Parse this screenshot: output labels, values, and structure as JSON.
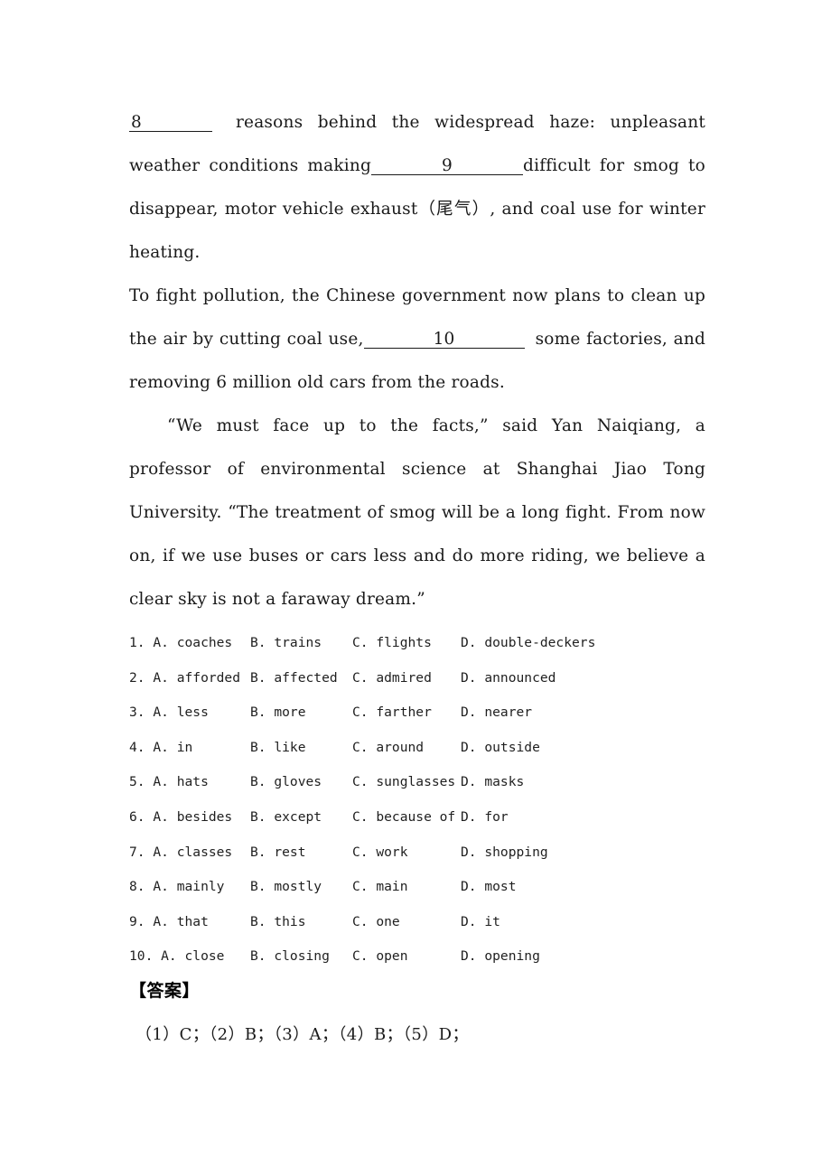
{
  "document": {
    "type": "cloze-test-worksheet",
    "background_color": "#ffffff",
    "text_color": "#1a1a1a"
  },
  "passage": {
    "paragraphs": [
      {
        "id": "p1",
        "indent": false,
        "segments": [
          {
            "kind": "blank",
            "number": "8",
            "style": "blank-8"
          },
          {
            "kind": "gap",
            "style": "gap-after-8"
          },
          {
            "kind": "text",
            "text": "reasons behind the widespread haze: unpleasant weather conditions making"
          },
          {
            "kind": "blank",
            "number": "9",
            "style": "blank-9"
          },
          {
            "kind": "text",
            "text": "difficult for smog to disappear, motor vehicle exhaust（尾气）, and coal use for winter heating."
          }
        ],
        "plain": "8______ reasons behind the widespread haze: unpleasant weather conditions making______9______difficult for smog to disappear, motor vehicle exhaust（尾气）, and coal use for winter heating."
      },
      {
        "id": "p2",
        "indent": false,
        "segments": [
          {
            "kind": "text",
            "text": "To fight pollution, the Chinese government now plans to clean up the air by cutting coal use,"
          },
          {
            "kind": "blank",
            "number": "10",
            "style": "blank-10"
          },
          {
            "kind": "gap",
            "style": "gap-after-10"
          },
          {
            "kind": "text",
            "text": "some factories, and removing 6 million old cars from the roads."
          }
        ],
        "plain": "To fight pollution, the Chinese government now plans to clean up the air by cutting coal use,______10______ some factories, and removing 6 million old cars from the roads."
      },
      {
        "id": "p3",
        "indent": true,
        "segments": [
          {
            "kind": "text",
            "text": "“We must face up to the facts,” said Yan Naiqiang, a professor of environmental science at Shanghai Jiao Tong University. “The treatment of smog will be a long fight. From now on, if we use buses or cars less and do more riding, we believe a clear sky is not a faraway dream.”"
          }
        ],
        "plain": "“We must face up to the facts,” said Yan Naiqiang, a professor of environmental science at Shanghai Jiao Tong University. “The treatment of smog will be a long fight. From now on, if we use buses or cars less and do more riding, we believe a clear sky is not a faraway dream.”"
      }
    ]
  },
  "questions": [
    {
      "number": "1",
      "a": "1. A. coaches",
      "b": "B. trains",
      "c": "C. flights",
      "d": "D. double-deckers"
    },
    {
      "number": "2",
      "a": "2. A. afforded",
      "b": "B. affected",
      "c": "C. admired",
      "d": "D. announced"
    },
    {
      "number": "3",
      "a": "3. A. less",
      "b": "B. more",
      "c": "C. farther",
      "d": "D. nearer"
    },
    {
      "number": "4",
      "a": "4. A. in",
      "b": "B. like",
      "c": "C. around",
      "d": "D. outside"
    },
    {
      "number": "5",
      "a": "5. A. hats",
      "b": "B. gloves",
      "c": "C. sunglasses",
      "d": "D. masks"
    },
    {
      "number": "6",
      "a": "6. A. besides",
      "b": "B. except",
      "c": "C. because of",
      "d": "D. for"
    },
    {
      "number": "7",
      "a": "7. A. classes",
      "b": "B. rest",
      "c": "C. work",
      "d": "D. shopping"
    },
    {
      "number": "8",
      "a": "8. A. mainly",
      "b": "B. mostly",
      "c": "C. main",
      "d": "D. most"
    },
    {
      "number": "9",
      "a": "9. A. that",
      "b": "B. this",
      "c": "C. one",
      "d": "D. it"
    },
    {
      "number": "10",
      "a": "10. A. close",
      "b": "B. closing",
      "c": "C. open",
      "d": "D. opening"
    }
  ],
  "answer_section": {
    "heading": "【答案】",
    "line": "（1）C；（2）B；（3）A；（4）B；（5）D；"
  }
}
